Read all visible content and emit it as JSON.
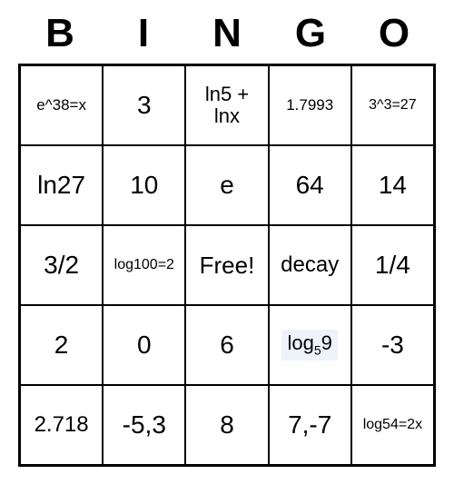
{
  "header": [
    "B",
    "I",
    "N",
    "G",
    "O"
  ],
  "cells": {
    "r0c0": "e^38=x",
    "r0c1": "3",
    "r0c2": "ln5 +\nlnx",
    "r0c3": "1.7993",
    "r0c4": "3^3=27",
    "r1c0": "ln27",
    "r1c1": "10",
    "r1c2": "e",
    "r1c3": "64",
    "r1c4": "14",
    "r2c0": "3/2",
    "r2c1": "log100=2",
    "r2c2": "Free!",
    "r2c3": "decay",
    "r2c4": "1/4",
    "r3c0": "2",
    "r3c1": "0",
    "r3c2": "6",
    "r3c3_prefix": "log",
    "r3c3_sub": "5",
    "r3c3_suffix": "9",
    "r3c4": "-3",
    "r4c0": "2.718",
    "r4c1": "-5,3",
    "r4c2": "8",
    "r4c3": "7,-7",
    "r4c4": "log54=2x"
  }
}
